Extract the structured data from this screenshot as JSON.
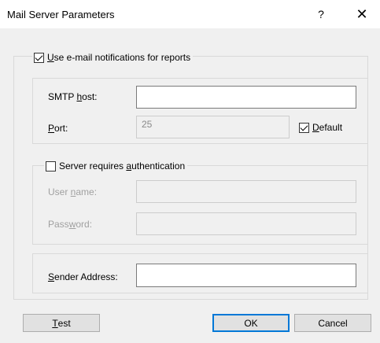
{
  "window": {
    "title": "Mail Server Parameters",
    "help_label": "?",
    "close_label": "✕"
  },
  "notifications": {
    "label_prefix": "",
    "label_accel": "U",
    "label_rest": "se e-mail notifications for reports",
    "checked": true
  },
  "smtp": {
    "host_label_prefix": "SMTP ",
    "host_label_accel": "h",
    "host_label_rest": "ost:",
    "host_value": "",
    "port_label_accel": "P",
    "port_label_rest": "ort:",
    "port_value": "25",
    "default_label_accel": "D",
    "default_label_rest": "efault",
    "default_checked": true
  },
  "auth": {
    "label_prefix": "Server requires ",
    "label_accel": "a",
    "label_rest": "uthentication",
    "checked": false,
    "username_label_prefix": "User ",
    "username_label_accel": "n",
    "username_label_rest": "ame:",
    "username_value": "",
    "password_label_prefix": "Pass",
    "password_label_accel": "w",
    "password_label_rest": "ord:",
    "password_value": ""
  },
  "sender": {
    "label_accel": "S",
    "label_rest": "ender Address:",
    "value": ""
  },
  "buttons": {
    "test_accel": "T",
    "test_rest": "est",
    "ok": "OK",
    "cancel": "Cancel"
  },
  "colors": {
    "dialog_bg": "#f0f0f0",
    "focus_blue": "#0078d7"
  }
}
